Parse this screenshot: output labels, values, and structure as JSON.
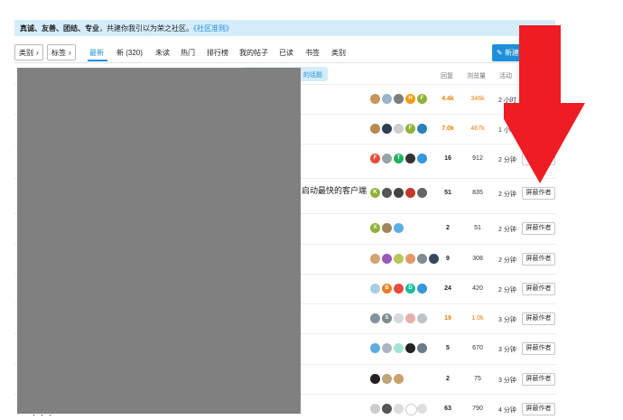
{
  "banner": {
    "values": "真诚、友善、团结、专业",
    "text": "，共建你我引以为荣之社区。",
    "link": "《社区准则》"
  },
  "nav": {
    "categories": "类别",
    "tags": "标签",
    "tabs": [
      "最新",
      "新 (320)",
      "未读",
      "热门",
      "排行榜",
      "我的帖子",
      "已读",
      "书签",
      "类别"
    ],
    "new_topic": "新建"
  },
  "new_topics_notice": "的话题",
  "columns": {
    "replies": "回复",
    "views": "浏览量",
    "activity": "活动"
  },
  "colors": {
    "accent": "#1f8fd9",
    "hot": "#e8820c",
    "arrow": "#ee1c24",
    "redaction": "#808080"
  },
  "rows": [
    {
      "title": "",
      "replies": "4.4k",
      "views": "346k",
      "activity": "2 小时",
      "hot": true,
      "block": "",
      "avatars": [
        [
          "#c8955c",
          ""
        ],
        [
          "#9db3c9",
          ""
        ],
        [
          "#7d7d7d",
          ""
        ],
        [
          "#f39c12",
          "H"
        ],
        [
          "#8fb339",
          "F"
        ]
      ]
    },
    {
      "title": "",
      "replies": "7.0k",
      "views": "467k",
      "activity": "1 小时",
      "hot": true,
      "block": "",
      "avatars": [
        [
          "#b78a52",
          ""
        ],
        [
          "#2c3e50",
          ""
        ],
        [
          "#cfcfcf",
          ""
        ],
        [
          "#8fb339",
          "F"
        ],
        [
          "#2980b9",
          ""
        ]
      ]
    },
    {
      "title": "",
      "replies": "16",
      "views": "912",
      "activity": "2 分钟",
      "hot": false,
      "block": "屏蔽",
      "avatars": [
        [
          "#e74c3c",
          "F"
        ],
        [
          "#95a5a6",
          ""
        ],
        [
          "#27ae60",
          "T"
        ],
        [
          "#333333",
          ""
        ],
        [
          "#3498db",
          ""
        ]
      ]
    },
    {
      "title": "启动最快的客户端",
      "replies": "51",
      "views": "835",
      "activity": "2 分钟",
      "hot": false,
      "block": "屏蔽作者",
      "avatars": [
        [
          "#8fb339",
          "K"
        ],
        [
          "#555555",
          ""
        ],
        [
          "#444444",
          ""
        ],
        [
          "#c0392b",
          ""
        ],
        [
          "#666666",
          ""
        ]
      ]
    },
    {
      "title": "",
      "replies": "2",
      "views": "51",
      "activity": "2 分钟",
      "hot": false,
      "block": "屏蔽作者",
      "avatars": [
        [
          "#8fb339",
          "X"
        ],
        [
          "#a0845c",
          ""
        ],
        [
          "#5dade2",
          ""
        ]
      ]
    },
    {
      "title": "",
      "replies": "9",
      "views": "308",
      "activity": "2 分钟",
      "hot": false,
      "block": "屏蔽作者",
      "avatars": [
        [
          "#d4a373",
          ""
        ],
        [
          "#9b59b6",
          ""
        ],
        [
          "#b5c85a",
          ""
        ],
        [
          "#e59866",
          ""
        ],
        [
          "#7f8c8d",
          ""
        ],
        [
          "#34495e",
          ""
        ]
      ]
    },
    {
      "title": "",
      "replies": "24",
      "views": "420",
      "activity": "2 分钟",
      "hot": false,
      "block": "屏蔽作者",
      "avatars": [
        [
          "#a9cce3",
          ""
        ],
        [
          "#e67e22",
          "B"
        ],
        [
          "#e74c3c",
          ""
        ],
        [
          "#1abc9c",
          "D"
        ],
        [
          "#3498db",
          ""
        ]
      ]
    },
    {
      "title": "",
      "replies": "19",
      "views": "1.0k",
      "activity": "3 分钟",
      "hot": true,
      "block": "屏蔽作者",
      "avatars": [
        [
          "#85929e",
          ""
        ],
        [
          "#7f8c8d",
          "S"
        ],
        [
          "#d5d8dc",
          ""
        ],
        [
          "#e6b0aa",
          ""
        ],
        [
          "#bdc3c7",
          ""
        ]
      ]
    },
    {
      "title": "",
      "replies": "5",
      "views": "670",
      "activity": "3 分钟",
      "hot": false,
      "block": "屏蔽作者",
      "avatars": [
        [
          "#5dade2",
          ""
        ],
        [
          "#aeb6bf",
          ""
        ],
        [
          "#a3e4d7",
          ""
        ],
        [
          "#222222",
          ""
        ],
        [
          "#6c7a89",
          ""
        ]
      ]
    },
    {
      "title": "",
      "replies": "2",
      "views": "75",
      "activity": "3 分钟",
      "hot": false,
      "block": "屏蔽作者",
      "avatars": [
        [
          "#222222",
          ""
        ],
        [
          "#bfa67a",
          ""
        ],
        [
          "#c9a36b",
          ""
        ]
      ]
    },
    {
      "title": "",
      "replies": "63",
      "views": "790",
      "activity": "4 分钟",
      "hot": false,
      "block": "屏蔽作者",
      "avatars": [
        [
          "#cccccc",
          ""
        ],
        [
          "#555555",
          ""
        ],
        [
          "#dddddd",
          ""
        ],
        [
          "#ffffff",
          ""
        ],
        [
          "#e0e0e0",
          ""
        ]
      ]
    }
  ],
  "footer_fragment": "・ ・ ・"
}
